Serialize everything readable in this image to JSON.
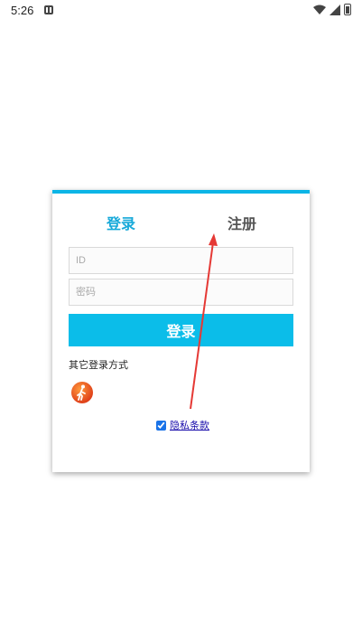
{
  "status": {
    "time": "5:26"
  },
  "tabs": {
    "login": "登录",
    "register": "注册"
  },
  "form": {
    "id_placeholder": "ID",
    "password_placeholder": "密码",
    "login_button": "登录"
  },
  "other_login": {
    "label": "其它登录方式",
    "guest_icon": "walking-person-icon"
  },
  "privacy": {
    "checked": true,
    "link_text": "隐私条款"
  },
  "colors": {
    "accent": "#0bbde9",
    "tab_active": "#17a9d9",
    "annotation": "#e53935"
  }
}
